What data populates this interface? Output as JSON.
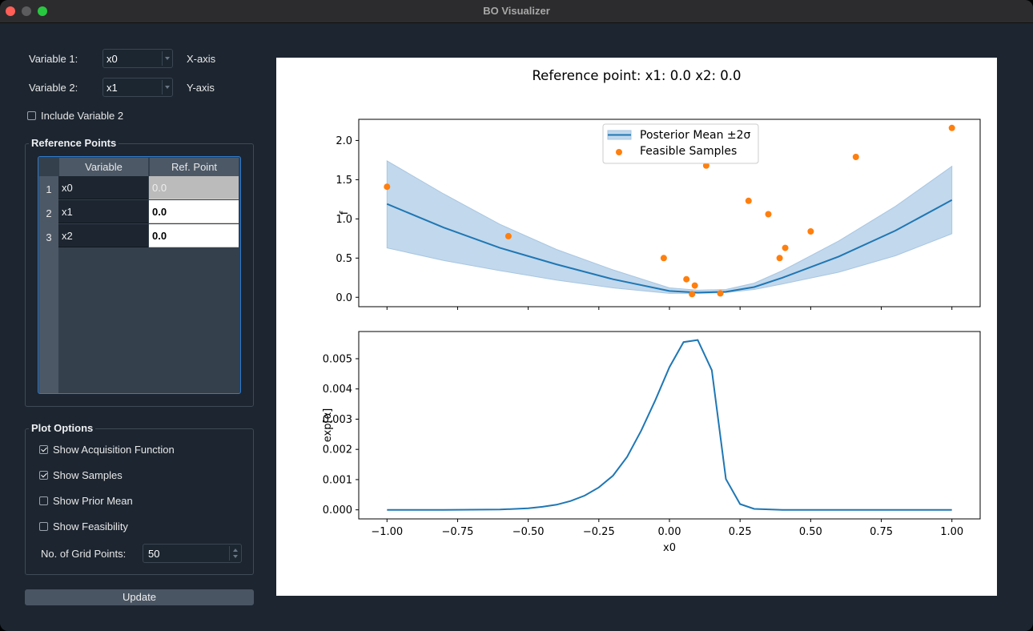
{
  "window": {
    "title": "BO Visualizer"
  },
  "controls": {
    "variable1_label": "Variable 1:",
    "variable1_value": "x0",
    "variable1_axis": "X-axis",
    "variable2_label": "Variable 2:",
    "variable2_value": "x1",
    "variable2_axis": "Y-axis",
    "include_var2_label": "Include Variable 2",
    "include_var2_checked": false
  },
  "reference_points": {
    "title": "Reference Points",
    "headers": [
      "Variable",
      "Ref. Point"
    ],
    "rows": [
      {
        "num": "1",
        "variable": "x0",
        "value": "0.0"
      },
      {
        "num": "2",
        "variable": "x1",
        "value": "0.0"
      },
      {
        "num": "3",
        "variable": "x2",
        "value": "0.0"
      }
    ]
  },
  "plot_options": {
    "title": "Plot Options",
    "items": [
      {
        "label": "Show Acquisition Function",
        "checked": true
      },
      {
        "label": "Show Samples",
        "checked": true
      },
      {
        "label": "Show Prior Mean",
        "checked": false
      },
      {
        "label": "Show Feasibility",
        "checked": false
      }
    ],
    "grid_points_label": "No. of Grid Points:",
    "grid_points_value": "50"
  },
  "update_button": "Update",
  "colors": {
    "mean_line": "#1f77b4",
    "band_fill": "#c2d8ec",
    "samples": "#ff7f0e"
  },
  "chart_data": [
    {
      "type": "line",
      "title": "Reference point: x1: 0.0 x2: 0.0",
      "xlabel": "",
      "ylabel": "f",
      "xlim": [
        -1.1,
        1.1
      ],
      "ylim": [
        -0.12,
        2.27
      ],
      "y_ticks": [
        "0.0",
        "0.5",
        "1.0",
        "1.5",
        "2.0"
      ],
      "y_tick_values": [
        0,
        0.5,
        1.0,
        1.5,
        2.0
      ],
      "legend": [
        "Posterior Mean ±2σ",
        "Feasible Samples"
      ],
      "legend_placement": "upper center",
      "series": [
        {
          "name": "Posterior Mean ±2σ",
          "x": [
            -1.0,
            -0.8,
            -0.6,
            -0.4,
            -0.2,
            0.0,
            0.1,
            0.2,
            0.3,
            0.4,
            0.6,
            0.8,
            1.0
          ],
          "values": [
            1.19,
            0.89,
            0.63,
            0.42,
            0.23,
            0.08,
            0.06,
            0.07,
            0.13,
            0.25,
            0.52,
            0.85,
            1.24
          ],
          "lower": [
            0.63,
            0.47,
            0.34,
            0.22,
            0.12,
            0.05,
            0.05,
            0.06,
            0.1,
            0.17,
            0.32,
            0.53,
            0.81
          ],
          "upper": [
            1.74,
            1.32,
            0.93,
            0.61,
            0.35,
            0.12,
            0.09,
            0.1,
            0.18,
            0.34,
            0.72,
            1.16,
            1.67
          ]
        },
        {
          "name": "Feasible Samples",
          "type": "scatter",
          "x": [
            -1.0,
            -0.57,
            -0.02,
            0.06,
            0.08,
            0.09,
            0.13,
            0.18,
            0.28,
            0.35,
            0.39,
            0.41,
            0.5,
            0.66,
            1.0
          ],
          "values": [
            1.41,
            0.78,
            0.5,
            0.23,
            0.04,
            0.15,
            1.68,
            0.05,
            1.23,
            1.06,
            0.5,
            0.63,
            0.84,
            1.79,
            2.16
          ]
        }
      ]
    },
    {
      "type": "line",
      "title": "",
      "xlabel": "x0",
      "ylabel": "exp[α]",
      "xlim": [
        -1.1,
        1.1
      ],
      "ylim": [
        -0.0003,
        0.0059
      ],
      "x_ticks": [
        "−1.00",
        "−0.75",
        "−0.50",
        "−0.25",
        "0.00",
        "0.25",
        "0.50",
        "0.75",
        "1.00"
      ],
      "x_tick_values": [
        -1.0,
        -0.75,
        -0.5,
        -0.25,
        0.0,
        0.25,
        0.5,
        0.75,
        1.0
      ],
      "y_ticks": [
        "0.000",
        "0.001",
        "0.002",
        "0.003",
        "0.004",
        "0.005"
      ],
      "y_tick_values": [
        0,
        0.001,
        0.002,
        0.003,
        0.004,
        0.005
      ],
      "series": [
        {
          "name": "",
          "x": [
            -1.0,
            -0.8,
            -0.6,
            -0.5,
            -0.45,
            -0.4,
            -0.35,
            -0.3,
            -0.25,
            -0.2,
            -0.15,
            -0.1,
            -0.05,
            0.0,
            0.05,
            0.1,
            0.15,
            0.2,
            0.25,
            0.3,
            0.4,
            0.6,
            0.8,
            1.0
          ],
          "values": [
            0.0,
            0.0,
            1e-05,
            5e-05,
            0.0001,
            0.00017,
            0.00029,
            0.00047,
            0.00074,
            0.00113,
            0.00175,
            0.00262,
            0.00363,
            0.00472,
            0.00555,
            0.00562,
            0.00462,
            0.00102,
            0.00019,
            3e-05,
            0.0,
            0.0,
            0.0,
            0.0
          ]
        }
      ]
    }
  ]
}
